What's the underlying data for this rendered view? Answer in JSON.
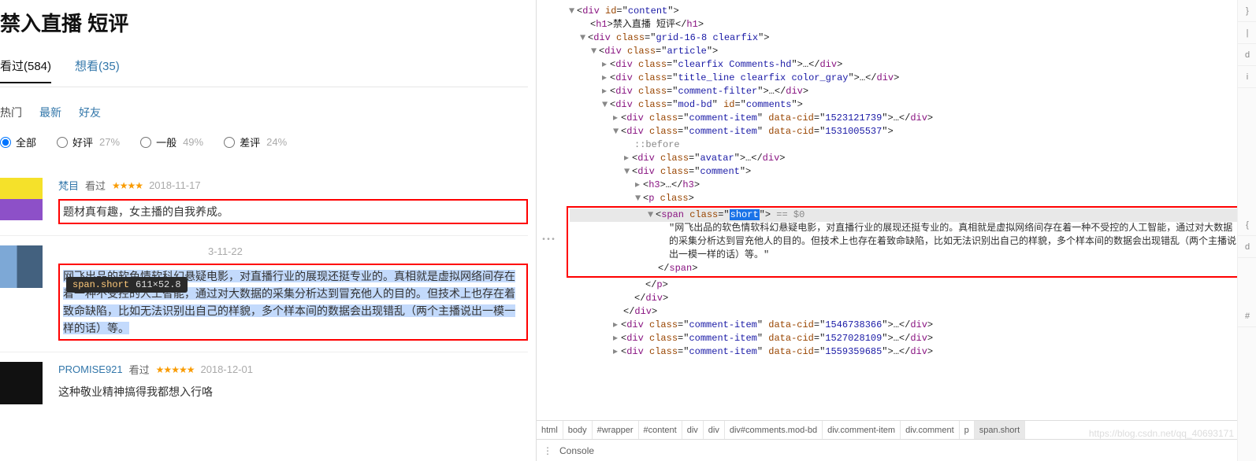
{
  "page_title": "禁入直播 短评",
  "tabs": {
    "watched": "看过(584)",
    "want": "想看(35)"
  },
  "subtabs": {
    "hot": "热门",
    "new": "最新",
    "friend": "好友"
  },
  "filters": {
    "all": "全部",
    "pos": "好评",
    "pos_pct": "27%",
    "mid": "一般",
    "mid_pct": "49%",
    "neg": "差评",
    "neg_pct": "24%"
  },
  "comments": [
    {
      "user": "梵目",
      "action": "看过",
      "stars": "★★★★",
      "date": "2018-11-17",
      "text": "题材真有趣，女主播的自我养成。"
    },
    {
      "user": "",
      "action": "",
      "stars_note": "",
      "date": "3-11-22",
      "text": "网飞出品的软色情软科幻悬疑电影，对直播行业的展现还挺专业的。真相就是虚拟网络间存在着一种不受控的人工智能，通过对大数据的采集分析达到冒充他人的目的。但技术上也存在着致命缺陷，比如无法识别出自己的样貌，多个样本间的数据会出现错乱（两个主播说出一模一样的话）等。"
    },
    {
      "user": "PROMISE921",
      "action": "看过",
      "stars": "★★★★★",
      "date": "2018-12-01",
      "text": "这种敬业精神搞得我都想入行咯"
    }
  ],
  "tooltip": {
    "selector": "span.short",
    "dims": "611×52.8"
  },
  "dom": {
    "content_id": "content",
    "h1_text": "禁入直播 短评",
    "grid_cls": "grid-16-8 clearfix",
    "article_cls": "article",
    "rows_collapsed": {
      "hd": "clearfix Comments-hd",
      "title_line": "title_line clearfix color_gray",
      "filter": "comment-filter"
    },
    "modbd_cls": "mod-bd",
    "modbd_id": "comments",
    "items_before": [
      {
        "cid": "1523121739"
      }
    ],
    "open_item_cid": "1531005537",
    "before_kw": "::before",
    "avatar_cls": "avatar",
    "comment_cls": "comment",
    "p_cls": "",
    "span_cls": "short",
    "selected_eq": " == $0",
    "span_text": "\"网飞出品的软色情软科幻悬疑电影，对直播行业的展现还挺专业的。真相就是虚拟网络间存在着一种不受控的人工智能，通过对大数据的采集分析达到冒充他人的目的。但技术上也存在着致命缺陷，比如无法识别出自己的样貌，多个样本间的数据会出现错乱（两个主播说出一模一样的话）等。\"",
    "items_after": [
      {
        "cid": "1546738366"
      },
      {
        "cid": "1527028109"
      },
      {
        "cid": "1559359685"
      }
    ]
  },
  "crumbs": [
    "html",
    "body",
    "#wrapper",
    "#content",
    "div",
    "div",
    "div#comments.mod-bd",
    "div.comment-item",
    "div.comment",
    "p",
    "span.short"
  ],
  "console_label": "Console",
  "watermark": "https://blog.csdn.net/qq_40693171",
  "gutter": "•••"
}
